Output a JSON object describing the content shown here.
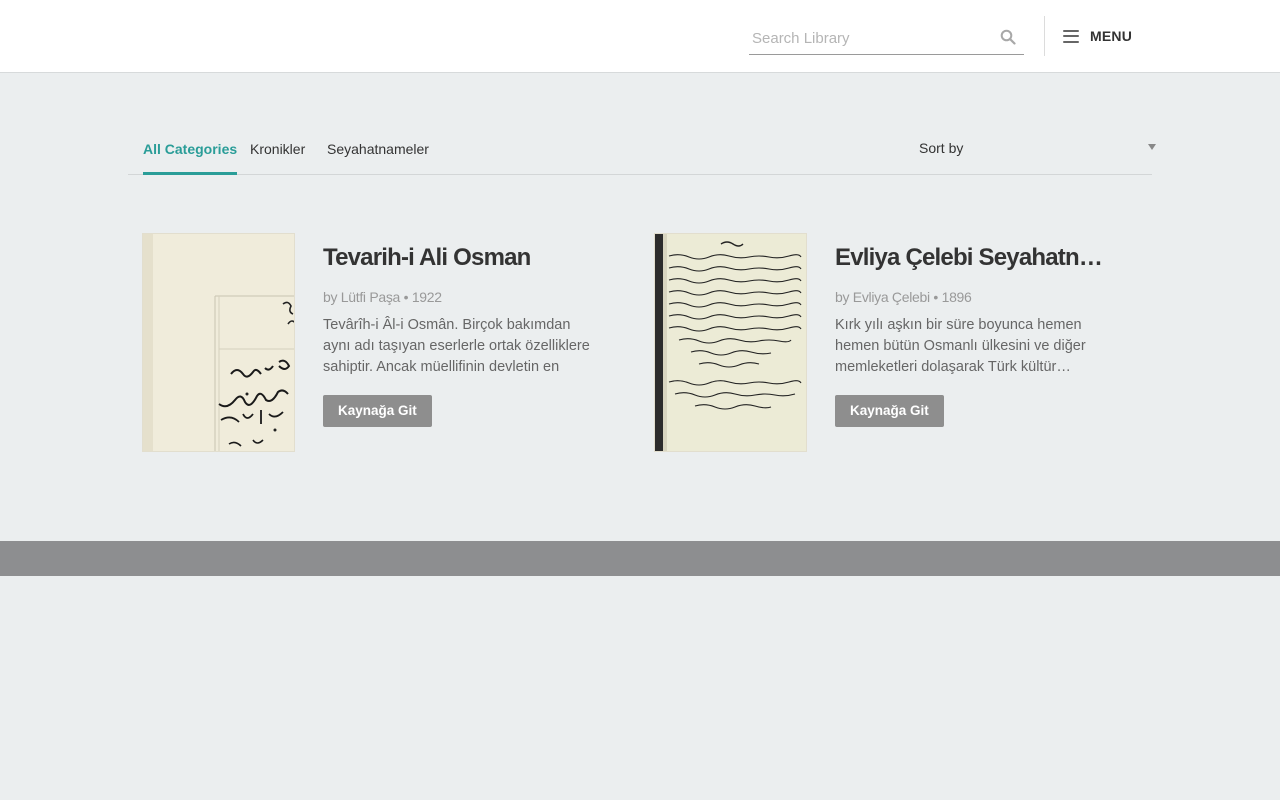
{
  "header": {
    "search_placeholder": "Search Library",
    "menu_label": "MENU"
  },
  "tabs": [
    {
      "label": "All Categories",
      "active": true
    },
    {
      "label": "Kronikler",
      "active": false
    },
    {
      "label": "Seyahatnameler",
      "active": false
    }
  ],
  "sort": {
    "label": "Sort by"
  },
  "cards": [
    {
      "title": "Tevarih-i Ali Osman",
      "author_prefix": "by",
      "author": "Lütfi Paşa",
      "year": "1922",
      "meta": "by Lütfi Paşa • 1922",
      "description": "Tevârîh-i Âl-i Osmân. Birçok bakımdan aynı adı taşıyan eserlerle ortak özelliklere sahiptir. Ancak müellifinin devletin en güç…",
      "button_label": "Kaynağa Git"
    },
    {
      "title": "Evliya Çelebi Seyahatn…",
      "author_prefix": "by",
      "author": "Evliya Çelebi",
      "year": "1896",
      "meta": "by Evliya Çelebi • 1896",
      "description": "Kırk yılı aşkın bir süre boyunca hemen hemen bütün Osmanlı ülkesini ve diğer memleketleri dolaşarak Türk kültür…",
      "button_label": "Kaynağa Git"
    }
  ],
  "colors": {
    "accent": "#2a9d98",
    "background": "#ebeeef",
    "button": "#8e8e8e",
    "footer": "#8d8e90"
  }
}
